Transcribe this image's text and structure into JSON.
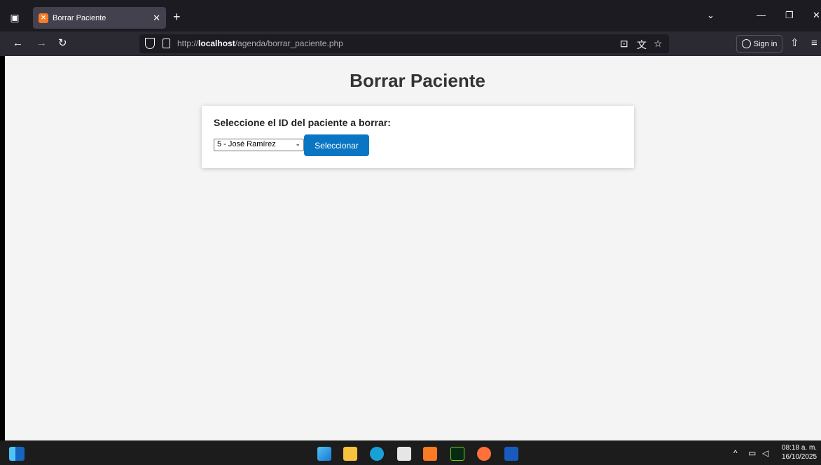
{
  "browser": {
    "tab_title": "Borrar Paciente",
    "url_prefix": "http://",
    "url_host": "localhost",
    "url_path": "/agenda/borrar_paciente.php",
    "sign_in_label": "Sign in"
  },
  "page": {
    "title": "Borrar Paciente",
    "select_label": "Seleccione el ID del paciente a borrar:",
    "selected_option": "5 - José Ramírez",
    "submit_label": "Seleccionar"
  },
  "taskbar": {
    "time": "08:18 a. m.",
    "date": "16/10/2025"
  },
  "colors": {
    "accent_button": "#0a75c2",
    "page_bg": "#f4f4f4"
  }
}
